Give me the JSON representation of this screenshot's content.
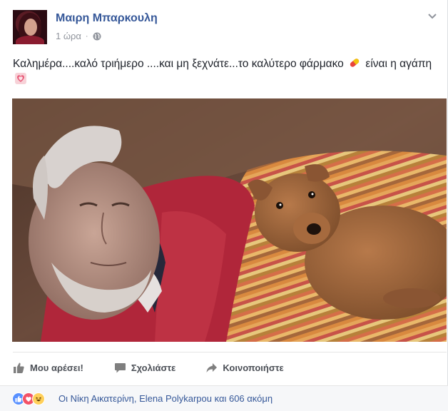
{
  "post": {
    "author": "Μαιρη Μπαρκουλη",
    "time": "1 ώρα",
    "separator": "·",
    "text_part1": "Καλημέρα....καλό τριήμερο ....και μη ξεχνάτε...το καλύτερο φάρμακο",
    "text_part2": "είναι η αγάπη",
    "pill_emoji_icon": "pill-icon",
    "heart_emoji_icon": "revolving-heart-icon",
    "photo_description_icon": "photo"
  },
  "actions": {
    "like_label": "Μου αρέσει!",
    "comment_label": "Σχολιάστε",
    "share_label": "Κοινοποιήστε"
  },
  "reactions": {
    "text": "Οι Νίκη Αικατερίνη, Elena Polykarpou και 606 ακόμη",
    "types": [
      "like",
      "love",
      "haha"
    ]
  },
  "colors": {
    "link": "#365899",
    "action_text": "#4b4f56",
    "meta_text": "#90949c",
    "like_blue": "#5890ff",
    "love_red": "#f25268",
    "haha_yellow": "#ffd05a"
  }
}
